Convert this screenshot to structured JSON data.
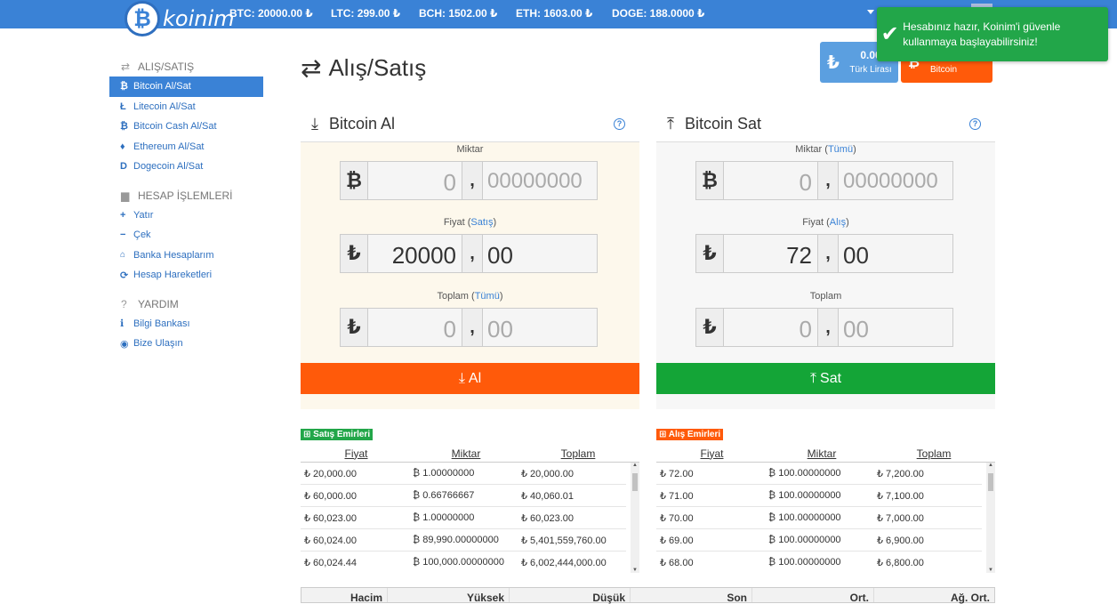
{
  "brand": {
    "name": "koinim",
    "symbol": "₿"
  },
  "tickers": [
    {
      "label": "BTC: 20000.00 ₺"
    },
    {
      "label": "LTC: 299.00 ₺"
    },
    {
      "label": "BCH: 1502.00 ₺"
    },
    {
      "label": "ETH: 1603.00 ₺"
    },
    {
      "label": "DOGE: 188.0000 ₺"
    }
  ],
  "toast": {
    "message": "Hesabınız hazır, Koinim'i güvenle kullanmaya başlayabilirsiniz!",
    "icon": "check-icon",
    "color": "#22a649"
  },
  "balances": {
    "try": {
      "amount": "0.00",
      "label": "Türk Lirası",
      "icon": "lira-icon"
    },
    "btc": {
      "label": "Bitcoin",
      "icon": "bitcoin-icon"
    }
  },
  "sidebar": {
    "sections": [
      {
        "title": "ALIŞ/SATIŞ",
        "icon": "exchange-icon",
        "items": [
          {
            "label": "Bitcoin Al/Sat",
            "icon": "₿",
            "active": true
          },
          {
            "label": "Litecoin Al/Sat",
            "icon": "Ł"
          },
          {
            "label": "Bitcoin Cash Al/Sat",
            "icon": "₿"
          },
          {
            "label": "Ethereum Al/Sat",
            "icon": "♦"
          },
          {
            "label": "Dogecoin Al/Sat",
            "icon": "D"
          }
        ]
      },
      {
        "title": "HESAP İŞLEMLERİ",
        "icon": "briefcase-icon",
        "items": [
          {
            "label": "Yatır",
            "icon": "+"
          },
          {
            "label": "Çek",
            "icon": "−"
          },
          {
            "label": "Banka Hesaplarım",
            "icon": "🏛"
          },
          {
            "label": "Hesap Hareketleri",
            "icon": "⟳"
          }
        ]
      },
      {
        "title": "YARDIM",
        "icon": "question-icon",
        "items": [
          {
            "label": "Bilgi Bankası",
            "icon": "ℹ"
          },
          {
            "label": "Bize Ulaşın",
            "icon": "💬"
          }
        ]
      }
    ]
  },
  "page": {
    "title": "Alış/Satış"
  },
  "buy": {
    "title": "Bitcoin Al",
    "amount_label": "Miktar",
    "amount_int": "0",
    "amount_dec": "00000000",
    "price_label": "Fiyat",
    "price_link": "Satış",
    "price_int": "20000",
    "price_dec": "00",
    "total_label": "Toplam",
    "total_link": "Tümü",
    "total_int": "0",
    "total_dec": "00",
    "button": "Al"
  },
  "sell": {
    "title": "Bitcoin Sat",
    "amount_label": "Miktar",
    "amount_link": "Tümü",
    "amount_int": "0",
    "amount_dec": "00000000",
    "price_label": "Fiyat",
    "price_link": "Alış",
    "price_int": "72",
    "price_dec": "00",
    "total_label": "Toplam",
    "total_int": "0",
    "total_dec": "00",
    "button": "Sat"
  },
  "sell_orders": {
    "title": "Satış Emirleri",
    "color": "#22a649",
    "columns": [
      "Fiyat",
      "Miktar",
      "Toplam"
    ],
    "rows": [
      [
        "₺ 20,000.00",
        "₿ 1.00000000",
        "₺ 20,000.00"
      ],
      [
        "₺ 60,000.00",
        "₿ 0.66766667",
        "₺ 40,060.01"
      ],
      [
        "₺ 60,023.00",
        "₿ 1.00000000",
        "₺ 60,023.00"
      ],
      [
        "₺ 60,024.00",
        "₿ 89,990.00000000",
        "₺ 5,401,559,760.00"
      ],
      [
        "₺ 60,024.44",
        "₿ 100,000.00000000",
        "₺ 6,002,444,000.00"
      ]
    ]
  },
  "buy_orders": {
    "title": "Alış Emirleri",
    "color": "#ff5a0a",
    "columns": [
      "Fiyat",
      "Miktar",
      "Toplam"
    ],
    "rows": [
      [
        "₺ 72.00",
        "₿ 100.00000000",
        "₺ 7,200.00"
      ],
      [
        "₺ 71.00",
        "₿ 100.00000000",
        "₺ 7,100.00"
      ],
      [
        "₺ 70.00",
        "₿ 100.00000000",
        "₺ 7,000.00"
      ],
      [
        "₺ 69.00",
        "₿ 100.00000000",
        "₺ 6,900.00"
      ],
      [
        "₺ 68.00",
        "₿ 100.00000000",
        "₺ 6,800.00"
      ]
    ]
  },
  "stats": {
    "columns": [
      "Hacim",
      "Yüksek",
      "Düşük",
      "Son",
      "Ort.",
      "Ağ. Ort."
    ]
  }
}
